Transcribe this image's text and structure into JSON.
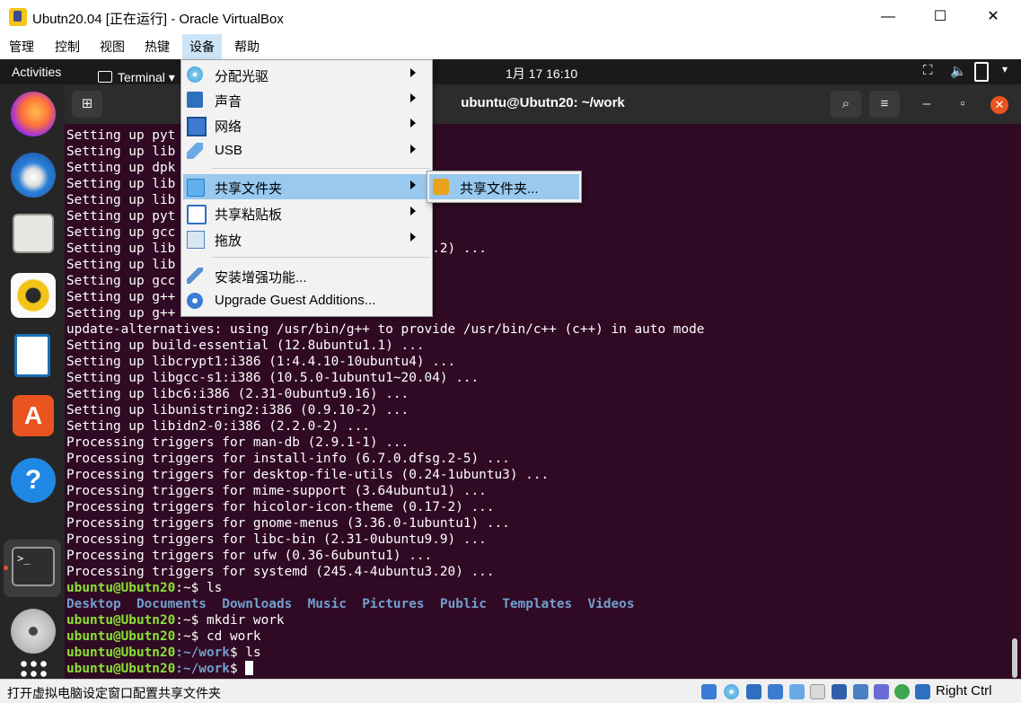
{
  "window": {
    "title": "Ubutn20.04 [正在运行] - Oracle VirtualBox",
    "minimize": "—",
    "maximize": "☐",
    "close": "✕"
  },
  "menubar": [
    "管理",
    "控制",
    "视图",
    "热键",
    "设备",
    "帮助"
  ],
  "guest_topbar": {
    "activities": "Activities",
    "app": "Terminal ▾",
    "clock": "1月 17  16:10"
  },
  "terminal": {
    "title": "ubuntu@Ubutn20: ~/work",
    "prompt_user": "ubuntu@Ubutn20",
    "prompt_home": ":~$ ",
    "prompt_work_path": ":~/work",
    "prompt_dollar": "$ "
  },
  "terminal_lines": [
    "Setting up pyt",
    "Setting up lib",
    "Setting up dpk",
    "Setting up lib",
    "Setting up lib",
    "Setting up pyt",
    "Setting up gcc",
    "Setting up lib",
    "Setting up lib",
    "Setting up gcc",
    "Setting up g++",
    "Setting up g++",
    "update-alternatives: using /usr/bin/g++ to provide /usr/bin/c++ (c++) in auto mode",
    "Setting up build-essential (12.8ubuntu1.1) ...",
    "Setting up libcrypt1:i386 (1:4.4.10-10ubuntu4) ...",
    "Setting up libgcc-s1:i386 (10.5.0-1ubuntu1~20.04) ...",
    "Setting up libc6:i386 (2.31-0ubuntu9.16) ...",
    "Setting up libunistring2:i386 (0.9.10-2) ...",
    "Setting up libidn2-0:i386 (2.2.0-2) ...",
    "Processing triggers for man-db (2.9.1-1) ...",
    "Processing triggers for install-info (6.7.0.dfsg.2-5) ...",
    "Processing triggers for desktop-file-utils (0.24-1ubuntu3) ...",
    "Processing triggers for mime-support (3.64ubuntu1) ...",
    "Processing triggers for hicolor-icon-theme (0.17-2) ...",
    "Processing triggers for gnome-menus (3.36.0-1ubuntu1) ...",
    "Processing triggers for libc-bin (2.31-0ubuntu9.9) ...",
    "Processing triggers for ufw (0.36-6ubuntu1) ...",
    "Processing triggers for systemd (245.4-4ubuntu3.20) ..."
  ],
  "partial_line_suffix": "u1~20.04.2) ...",
  "commands": {
    "ls": "ls",
    "mkdir": "mkdir work",
    "cd": "cd work",
    "ls2": "ls"
  },
  "ls_output": [
    "Desktop",
    "Documents",
    "Downloads",
    "Music",
    "Pictures",
    "Public",
    "Templates",
    "Videos"
  ],
  "devices_menu": [
    {
      "label": "分配光驱",
      "submenu": true
    },
    {
      "label": "声音",
      "submenu": true
    },
    {
      "label": "网络",
      "submenu": true
    },
    {
      "label": "USB",
      "submenu": true
    },
    {
      "label": "共享文件夹",
      "submenu": true,
      "highlighted": true
    },
    {
      "label": "共享粘贴板",
      "submenu": true
    },
    {
      "label": "拖放",
      "submenu": true
    },
    {
      "label": "安装增强功能...",
      "submenu": false
    },
    {
      "label": "Upgrade Guest Additions...",
      "submenu": false
    }
  ],
  "shared_folder_submenu": {
    "label": "共享文件夹..."
  },
  "statusbar": {
    "text": "打开虚拟电脑设定窗口配置共享文件夹",
    "host_key": "Right Ctrl"
  }
}
